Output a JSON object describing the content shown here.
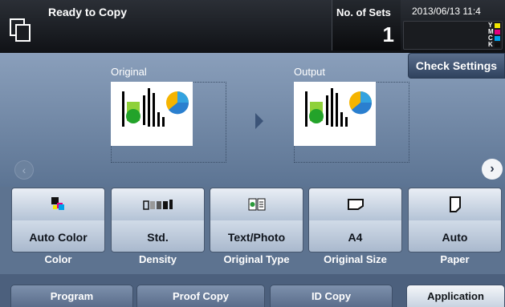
{
  "header": {
    "status": "Ready to Copy",
    "sets_label": "No. of Sets",
    "sets_value": "1",
    "datetime": "2013/06/13 11:4",
    "toner": [
      {
        "label": "Y",
        "color": "#f2e600"
      },
      {
        "label": "M",
        "color": "#e4007f"
      },
      {
        "label": "C",
        "color": "#00a0e9"
      },
      {
        "label": "K",
        "color": "#111111"
      }
    ]
  },
  "main": {
    "check_settings": "Check Settings",
    "original_label": "Original",
    "output_label": "Output"
  },
  "functions": [
    {
      "value": "Auto Color",
      "caption": "Color"
    },
    {
      "value": "Std.",
      "caption": "Density"
    },
    {
      "value": "Text/Photo",
      "caption": "Original Type"
    },
    {
      "value": "A4",
      "caption": "Original Size"
    },
    {
      "value": "Auto",
      "caption": "Paper"
    }
  ],
  "tabs": [
    "Program",
    "Proof Copy",
    "ID Copy",
    "Application"
  ],
  "colors": {
    "accent": "#5d7390"
  }
}
